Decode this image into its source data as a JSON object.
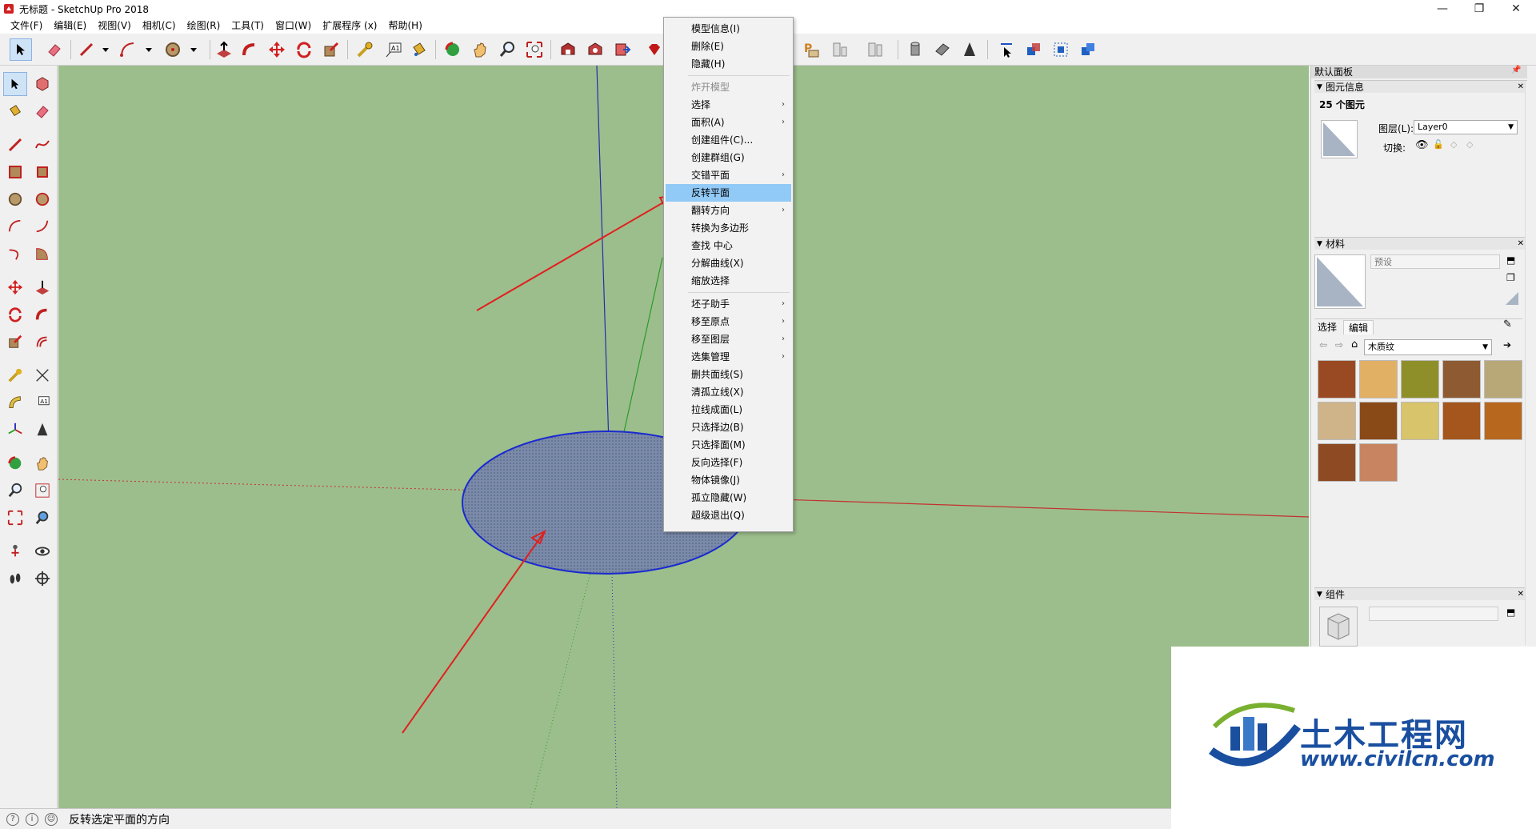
{
  "window": {
    "title": "无标题 - SketchUp Pro 2018",
    "minimize": "—",
    "maximize": "❐",
    "close": "✕"
  },
  "menubar": [
    "文件(F)",
    "编辑(E)",
    "视图(V)",
    "相机(C)",
    "绘图(R)",
    "工具(T)",
    "窗口(W)",
    "扩展程序 (x)",
    "帮助(H)"
  ],
  "context_menu": {
    "items": [
      {
        "label": "模型信息(I)",
        "submenu": false,
        "disabled": false
      },
      {
        "label": "删除(E)",
        "submenu": false,
        "disabled": false
      },
      {
        "label": "隐藏(H)",
        "submenu": false,
        "disabled": false
      },
      {
        "label": "炸开模型",
        "submenu": false,
        "disabled": true
      },
      {
        "label": "选择",
        "submenu": true,
        "disabled": false
      },
      {
        "label": "面积(A)",
        "submenu": true,
        "disabled": false
      },
      {
        "label": "创建组件(C)...",
        "submenu": false,
        "disabled": false
      },
      {
        "label": "创建群组(G)",
        "submenu": false,
        "disabled": false
      },
      {
        "label": "交错平面",
        "submenu": true,
        "disabled": false
      },
      {
        "label": "反转平面",
        "submenu": false,
        "disabled": false,
        "highlighted": true
      },
      {
        "label": "翻转方向",
        "submenu": true,
        "disabled": false
      },
      {
        "label": "转换为多边形",
        "submenu": false,
        "disabled": false
      },
      {
        "label": "查找 中心",
        "submenu": false,
        "disabled": false
      },
      {
        "label": "分解曲线(X)",
        "submenu": false,
        "disabled": false
      },
      {
        "label": "缩放选择",
        "submenu": false,
        "disabled": false
      },
      {
        "label": "坯子助手",
        "submenu": true,
        "disabled": false
      },
      {
        "label": "移至原点",
        "submenu": true,
        "disabled": false
      },
      {
        "label": "移至图层",
        "submenu": true,
        "disabled": false
      },
      {
        "label": "选集管理",
        "submenu": true,
        "disabled": false
      },
      {
        "label": "删共面线(S)",
        "submenu": false,
        "disabled": false
      },
      {
        "label": "清孤立线(X)",
        "submenu": false,
        "disabled": false
      },
      {
        "label": "拉线成面(L)",
        "submenu": false,
        "disabled": false
      },
      {
        "label": "只选择边(B)",
        "submenu": false,
        "disabled": false
      },
      {
        "label": "只选择面(M)",
        "submenu": false,
        "disabled": false
      },
      {
        "label": "反向选择(F)",
        "submenu": false,
        "disabled": false
      },
      {
        "label": "物体镜像(J)",
        "submenu": false,
        "disabled": false
      },
      {
        "label": "孤立隐藏(W)",
        "submenu": false,
        "disabled": false
      },
      {
        "label": "超级退出(Q)",
        "submenu": false,
        "disabled": false
      }
    ]
  },
  "tray": {
    "title": "默认面板",
    "entity_info": {
      "header": "图元信息",
      "count": "25 个图元",
      "layer_label": "图层(L):",
      "layer_value": "Layer0",
      "toggle_label": "切换:"
    },
    "materials": {
      "header": "材料",
      "name_placeholder": "预设",
      "tab_select": "选择",
      "tab_edit": "编辑",
      "library": "木质纹",
      "swatch_colors": [
        "#9a4a22",
        "#e2b065",
        "#8f8f2a",
        "#8e5a32",
        "#b8a878",
        "#cfb48a",
        "#8a4a18",
        "#d8c46a",
        "#a4561c",
        "#b8681e",
        "#8e4a22",
        "#c88460"
      ]
    },
    "components": {
      "header": "组件"
    }
  },
  "statusbar": {
    "text": "反转选定平面的方向"
  },
  "watermark": {
    "title": "土木工程网",
    "url": "www.civilcn.com"
  },
  "colors": {
    "viewport_bg": "#9cbe8c",
    "axis_red": "#c43030",
    "axis_green": "#2a9a2a",
    "axis_blue": "#2a2ab0",
    "highlight": "#91c9f7",
    "arrow_red": "#e02020"
  }
}
